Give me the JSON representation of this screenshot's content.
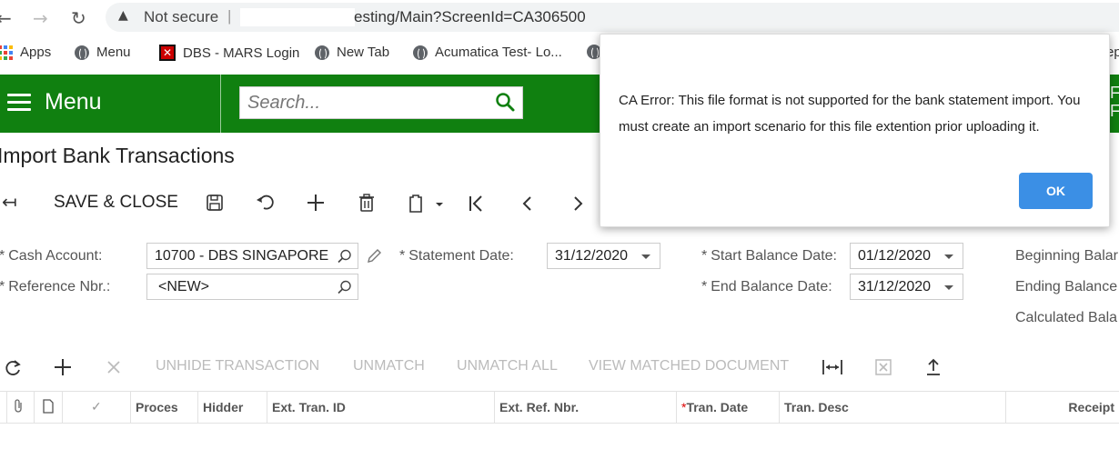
{
  "browser": {
    "security_label": "Not secure",
    "separator": "|",
    "url": "esting/Main?ScreenId=CA306500",
    "bookmarks": [
      {
        "label": "Apps"
      },
      {
        "label": "Menu"
      },
      {
        "label": "DBS - MARS Login"
      },
      {
        "label": "New Tab"
      },
      {
        "label": "Acumatica Test- Lo..."
      }
    ],
    "bookmark_overflow": "ep"
  },
  "header": {
    "menu_label": "Menu",
    "search_placeholder": "Search...",
    "right_edge_text": "F\nF"
  },
  "page": {
    "title": "Import Bank Transactions"
  },
  "toolbar": {
    "save_close_label": "SAVE & CLOSE"
  },
  "form": {
    "cash_account_label": "Cash Account:",
    "cash_account_value": "10700 - DBS SINGAPORE",
    "reference_nbr_label": "Reference Nbr.:",
    "reference_nbr_value": "<NEW>",
    "statement_date_label": "Statement Date:",
    "statement_date_value": "31/12/2020",
    "start_balance_date_label": "Start Balance Date:",
    "start_balance_date_value": "01/12/2020",
    "end_balance_date_label": "End Balance Date:",
    "end_balance_date_value": "31/12/2020",
    "beginning_balance_label": "Beginning Balar",
    "ending_balance_label": "Ending Balance",
    "calculated_balance_label": "Calculated Bala"
  },
  "grid_toolbar": {
    "unhide_transaction": "UNHIDE TRANSACTION",
    "unmatch": "UNMATCH",
    "unmatch_all": "UNMATCH ALL",
    "view_matched_document": "VIEW MATCHED DOCUMENT"
  },
  "grid": {
    "columns": [
      "Proces",
      "Hidder",
      "Ext. Tran. ID",
      "Ext. Ref. Nbr.",
      "Tran. Date",
      "Tran. Desc",
      "Receipt"
    ]
  },
  "dialog": {
    "message": "CA Error: This file format is not supported for the bank statement import. You must create an import scenario for this file extention prior uploading it.",
    "ok_label": "OK"
  },
  "colors": {
    "header_green": "#108010",
    "ok_blue": "#3b8fe5",
    "required_star": "#dd0000"
  }
}
